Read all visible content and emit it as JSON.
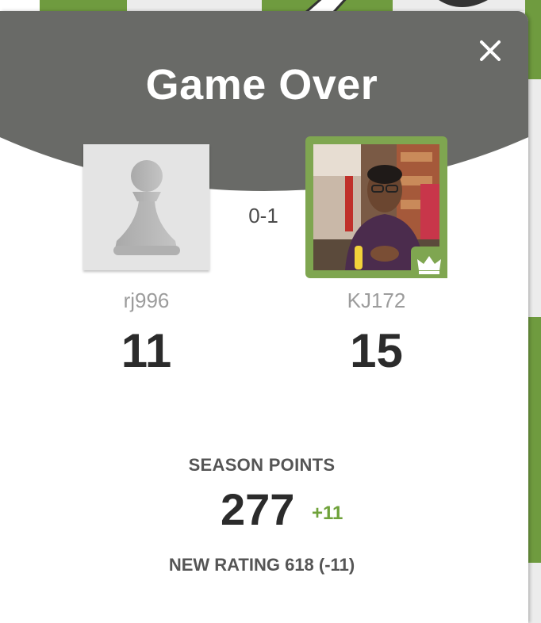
{
  "modal": {
    "title": "Game Over",
    "close_icon": "close-icon"
  },
  "players": {
    "left": {
      "username": "rj996",
      "value": "11",
      "avatar_icon": "pawn-icon"
    },
    "right": {
      "username": "KJ172",
      "value": "15",
      "badge_icon": "crown-icon"
    }
  },
  "result": {
    "score": "0-1"
  },
  "season": {
    "label": "SEASON POINTS",
    "points": "277",
    "delta": "+11"
  },
  "rating": {
    "text": "NEW RATING 618 (-11)"
  },
  "colors": {
    "header": "#696a67",
    "accent_green": "#7fa650",
    "delta_green": "#6fa23a",
    "board_green": "#6f9b3f"
  }
}
